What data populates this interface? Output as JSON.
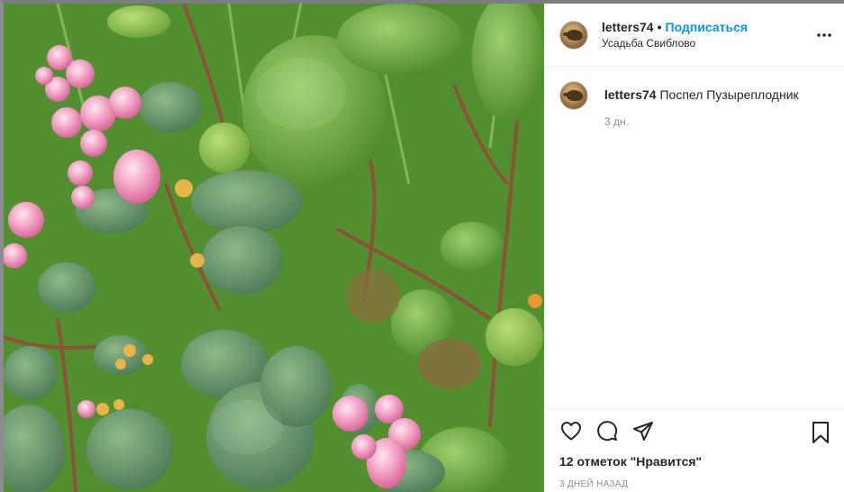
{
  "post": {
    "image_alt": "",
    "author": {
      "username": "letters74",
      "follow_label": "Подписаться",
      "separator": "•",
      "location": "Усадьба Свиблово"
    },
    "caption": {
      "username": "letters74",
      "text": "Поспел Пузыреплодник",
      "time": "3 дн."
    },
    "likes_text": "12 отметок \"Нравится\"",
    "date_text": "3 ДНЕЙ НАЗАД"
  },
  "icons": {
    "more": "more-options-icon",
    "like": "heart-icon",
    "comment": "comment-bubble-icon",
    "share": "send-icon",
    "save": "bookmark-icon"
  },
  "colors": {
    "accent": "#0095f6",
    "text": "#262626",
    "muted": "#8e8e8e"
  }
}
